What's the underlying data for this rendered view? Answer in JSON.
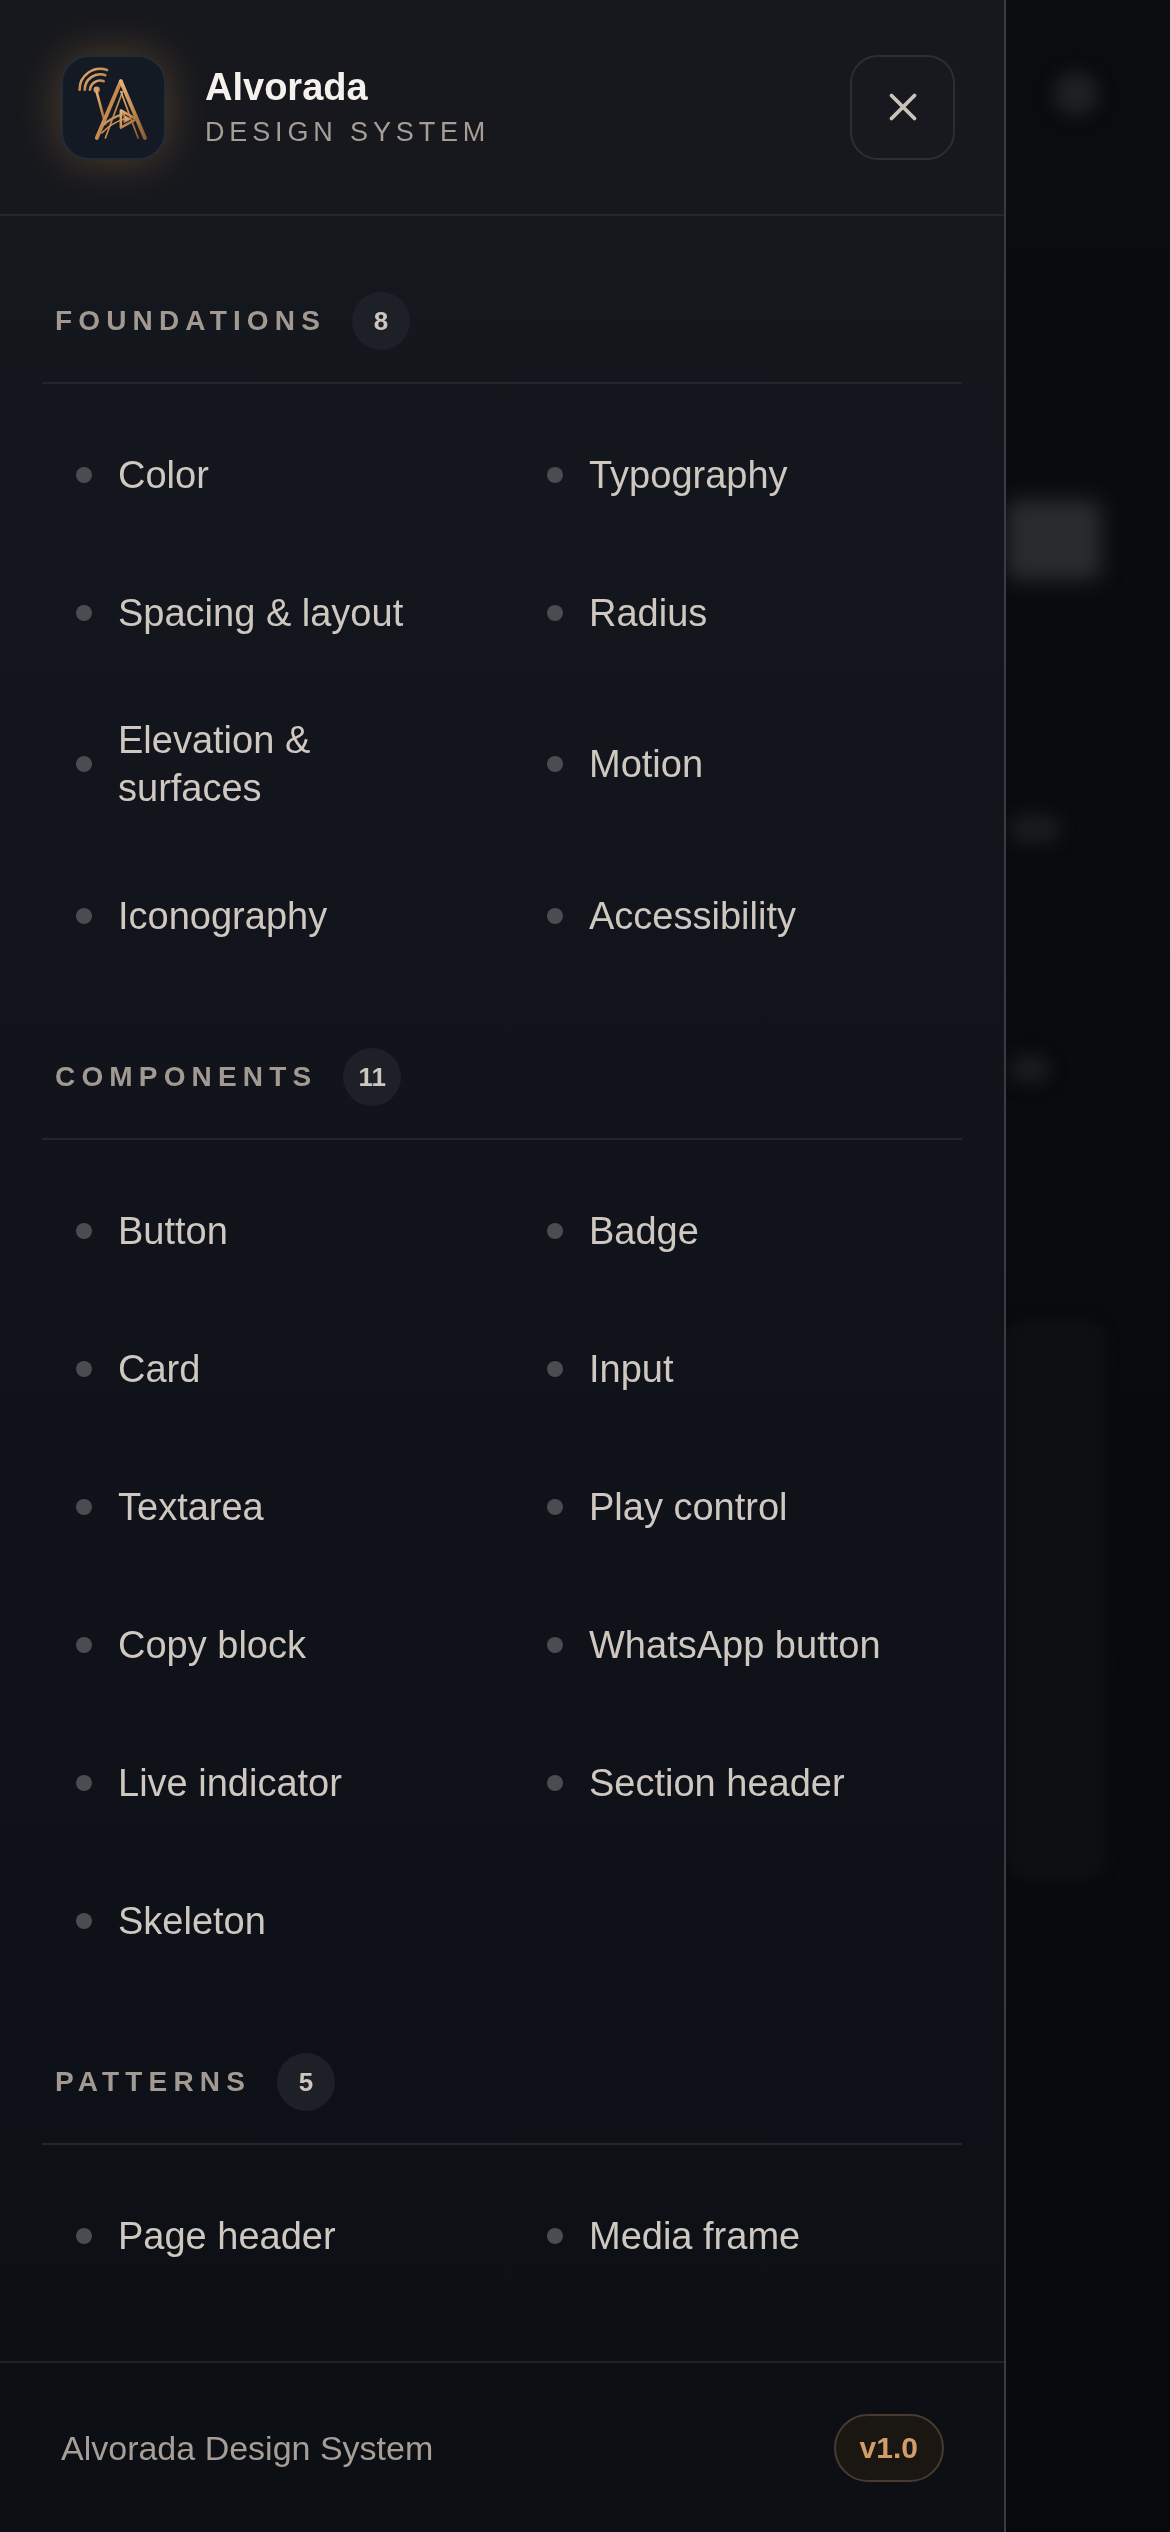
{
  "header": {
    "title": "Alvorada",
    "subtitle": "DESIGN SYSTEM"
  },
  "sections": [
    {
      "heading": "FOUNDATIONS",
      "count": "8",
      "items": [
        "Color",
        "Typography",
        "Spacing & layout",
        "Radius",
        "Elevation & surfaces",
        "Motion",
        "Iconography",
        "Accessibility"
      ]
    },
    {
      "heading": "COMPONENTS",
      "count": "11",
      "items": [
        "Button",
        "Badge",
        "Card",
        "Input",
        "Textarea",
        "Play control",
        "Copy block",
        "WhatsApp button",
        "Live indicator",
        "Section header",
        "Skeleton"
      ]
    },
    {
      "heading": "PATTERNS",
      "count": "5",
      "items": [
        "Page header",
        "Media frame"
      ]
    }
  ],
  "footer": {
    "text": "Alvorada Design System",
    "version": "v1.0"
  }
}
